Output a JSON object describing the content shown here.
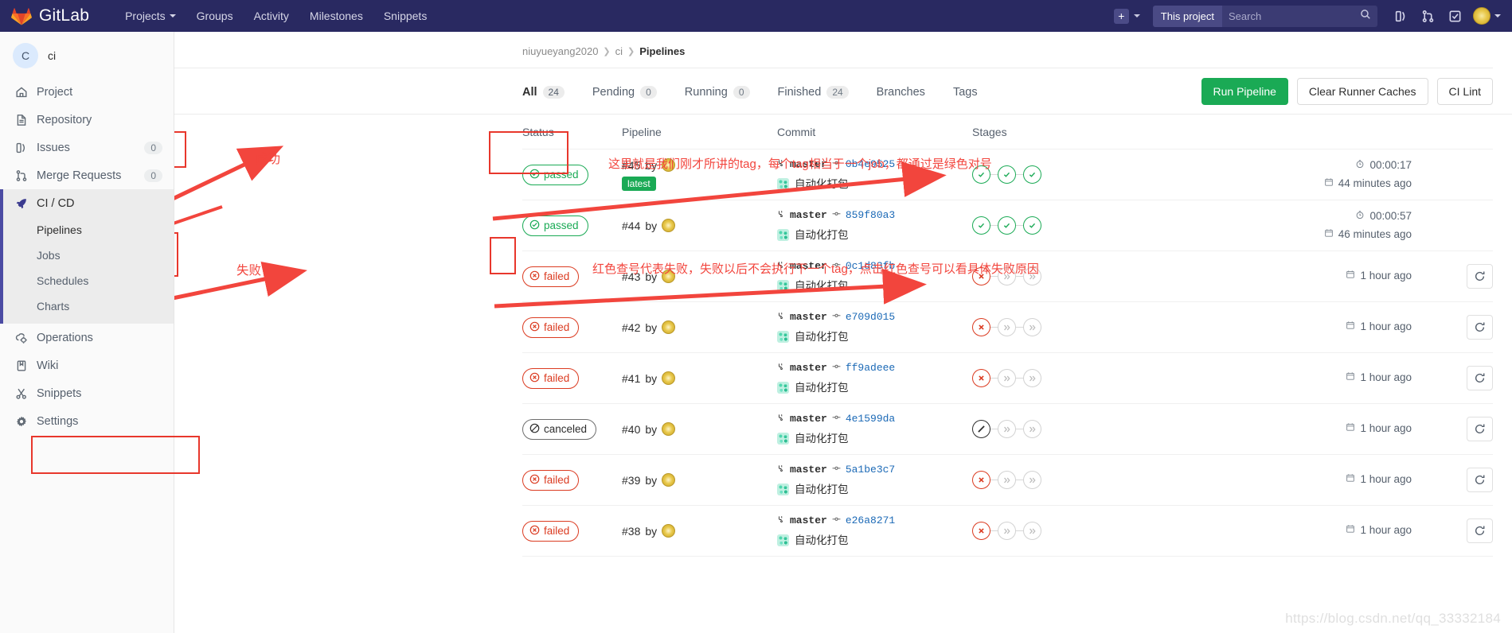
{
  "navbar": {
    "brand": "GitLab",
    "links": [
      {
        "label": "Projects",
        "has_caret": true
      },
      {
        "label": "Groups",
        "has_caret": false
      },
      {
        "label": "Activity",
        "has_caret": false
      },
      {
        "label": "Milestones",
        "has_caret": false
      },
      {
        "label": "Snippets",
        "has_caret": false
      }
    ],
    "plus_icon": "plus-icon",
    "search_scope": "This project",
    "search_placeholder": "Search",
    "search_value": "",
    "icons": [
      "issues-icon",
      "merge-requests-icon",
      "todos-icon"
    ]
  },
  "sidebar": {
    "project_initial": "C",
    "project_name": "ci",
    "items": [
      {
        "label": "Project",
        "icon": "home-icon",
        "badge": ""
      },
      {
        "label": "Repository",
        "icon": "file-icon",
        "badge": ""
      },
      {
        "label": "Issues",
        "icon": "issues-icon",
        "badge": "0"
      },
      {
        "label": "Merge Requests",
        "icon": "merge-requests-icon",
        "badge": "0"
      },
      {
        "label": "CI / CD",
        "icon": "rocket-icon",
        "badge": "",
        "active": true
      },
      {
        "label": "Operations",
        "icon": "operations-icon",
        "badge": ""
      },
      {
        "label": "Wiki",
        "icon": "book-icon",
        "badge": ""
      },
      {
        "label": "Snippets",
        "icon": "scissors-icon",
        "badge": ""
      },
      {
        "label": "Settings",
        "icon": "gear-icon",
        "badge": ""
      }
    ],
    "subitems": [
      {
        "label": "Pipelines",
        "current": true
      },
      {
        "label": "Jobs",
        "current": false
      },
      {
        "label": "Schedules",
        "current": false
      },
      {
        "label": "Charts",
        "current": false
      }
    ]
  },
  "breadcrumb": {
    "owner": "niuyueyang2020",
    "project": "ci",
    "page": "Pipelines"
  },
  "tabs": [
    {
      "label": "All",
      "count": "24",
      "active": true
    },
    {
      "label": "Pending",
      "count": "0",
      "active": false
    },
    {
      "label": "Running",
      "count": "0",
      "active": false
    },
    {
      "label": "Finished",
      "count": "24",
      "active": false
    },
    {
      "label": "Branches",
      "count": "",
      "active": false
    },
    {
      "label": "Tags",
      "count": "",
      "active": false
    }
  ],
  "actions": {
    "run_pipeline": "Run Pipeline",
    "clear_caches": "Clear Runner Caches",
    "ci_lint": "CI Lint"
  },
  "table": {
    "headers": [
      "Status",
      "Pipeline",
      "Commit",
      "Stages"
    ],
    "rows": [
      {
        "status": "passed",
        "status_kind": "passed",
        "pipeline_id": "#45",
        "by": "by",
        "latest": "latest",
        "branch": "master",
        "sha": "0b4e9525",
        "commit_msg": "自动化打包",
        "stages": [
          "ok",
          "ok",
          "ok"
        ],
        "duration": "00:00:17",
        "when": "44 minutes ago",
        "retry": false
      },
      {
        "status": "passed",
        "status_kind": "passed",
        "pipeline_id": "#44",
        "by": "by",
        "latest": "",
        "branch": "master",
        "sha": "859f80a3",
        "commit_msg": "自动化打包",
        "stages": [
          "ok",
          "ok",
          "ok"
        ],
        "duration": "00:00:57",
        "when": "46 minutes ago",
        "retry": false
      },
      {
        "status": "failed",
        "status_kind": "failed",
        "pipeline_id": "#43",
        "by": "by",
        "latest": "",
        "branch": "master",
        "sha": "0c1d83fb",
        "commit_msg": "自动化打包",
        "stages": [
          "bad",
          "skip",
          "skip"
        ],
        "duration": "",
        "when": "1 hour ago",
        "retry": true
      },
      {
        "status": "failed",
        "status_kind": "failed",
        "pipeline_id": "#42",
        "by": "by",
        "latest": "",
        "branch": "master",
        "sha": "e709d015",
        "commit_msg": "自动化打包",
        "stages": [
          "bad",
          "skip",
          "skip"
        ],
        "duration": "",
        "when": "1 hour ago",
        "retry": true
      },
      {
        "status": "failed",
        "status_kind": "failed",
        "pipeline_id": "#41",
        "by": "by",
        "latest": "",
        "branch": "master",
        "sha": "ff9adeee",
        "commit_msg": "自动化打包",
        "stages": [
          "bad",
          "skip",
          "skip"
        ],
        "duration": "",
        "when": "1 hour ago",
        "retry": true
      },
      {
        "status": "canceled",
        "status_kind": "canceled",
        "pipeline_id": "#40",
        "by": "by",
        "latest": "",
        "branch": "master",
        "sha": "4e1599da",
        "commit_msg": "自动化打包",
        "stages": [
          "cancel",
          "skip",
          "skip"
        ],
        "duration": "",
        "when": "1 hour ago",
        "retry": true
      },
      {
        "status": "failed",
        "status_kind": "failed",
        "pipeline_id": "#39",
        "by": "by",
        "latest": "",
        "branch": "master",
        "sha": "5a1be3c7",
        "commit_msg": "自动化打包",
        "stages": [
          "bad",
          "skip",
          "skip"
        ],
        "duration": "",
        "when": "1 hour ago",
        "retry": true
      },
      {
        "status": "failed",
        "status_kind": "failed",
        "pipeline_id": "#38",
        "by": "by",
        "latest": "",
        "branch": "master",
        "sha": "e26a8271",
        "commit_msg": "自动化打包",
        "stages": [
          "bad",
          "skip",
          "skip"
        ],
        "duration": "",
        "when": "1 hour ago",
        "retry": true
      }
    ]
  },
  "annotations": {
    "success_label": "成功",
    "fail_label": "失败",
    "stages_note": "这里就是我们刚才所讲的tag，每个tag相当于一个job，都通过是绿色对号",
    "fail_note": "红色查号代表失败，失败以后不会执行下一个tag，点击红色查号可以看具体失败原因",
    "color": "#f2453d"
  },
  "watermark": "https://blog.csdn.net/qq_33332184"
}
